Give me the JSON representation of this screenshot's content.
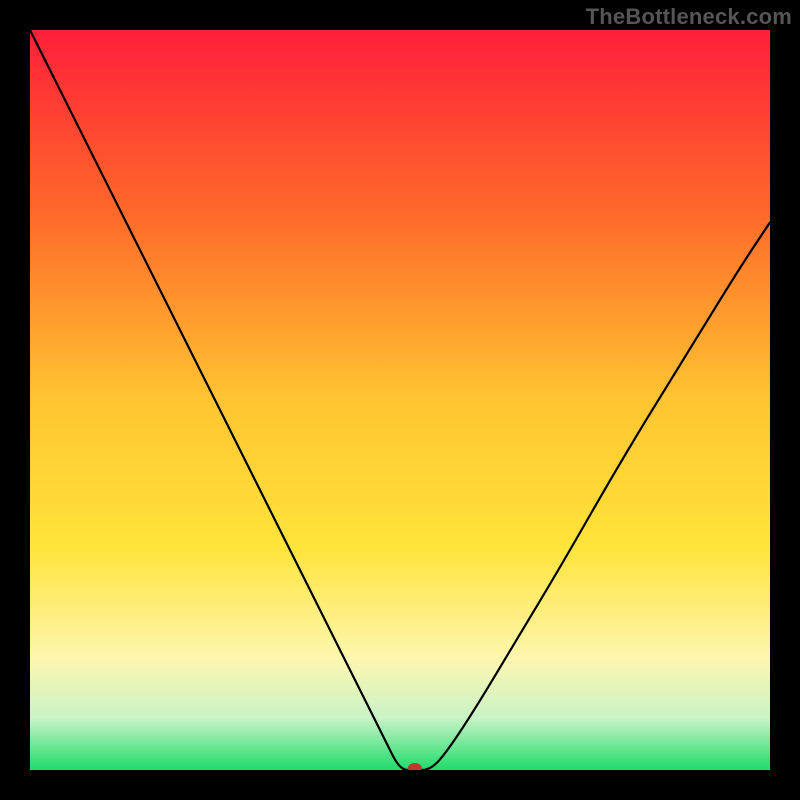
{
  "watermark": "TheBottleneck.com",
  "chart_data": {
    "type": "line",
    "title": "",
    "xlabel": "",
    "ylabel": "",
    "xlim": [
      0,
      100
    ],
    "ylim": [
      0,
      100
    ],
    "grid": false,
    "legend": false,
    "background_gradient": {
      "stops": [
        {
          "offset": 0.0,
          "color": "#ff1f3a"
        },
        {
          "offset": 0.25,
          "color": "#ff6a2a"
        },
        {
          "offset": 0.5,
          "color": "#ffc531"
        },
        {
          "offset": 0.7,
          "color": "#ffe43a"
        },
        {
          "offset": 0.85,
          "color": "#fdf6b0"
        },
        {
          "offset": 0.93,
          "color": "#c9f3c6"
        },
        {
          "offset": 1.0,
          "color": "#1fdc6b"
        }
      ]
    },
    "series": [
      {
        "name": "bottleneck-curve",
        "stroke": "#000000",
        "stroke_width": 2.2,
        "x": [
          0,
          4,
          8,
          12,
          16,
          20,
          24,
          28,
          32,
          36,
          40,
          44,
          48,
          50,
          52,
          54,
          56,
          60,
          66,
          72,
          80,
          88,
          96,
          100
        ],
        "y": [
          100,
          92,
          84,
          76,
          68,
          60,
          52,
          44,
          36,
          28,
          20,
          12,
          4,
          0,
          0,
          0,
          2,
          8,
          18,
          28,
          42,
          55,
          68,
          74
        ]
      }
    ],
    "marker": {
      "name": "optimum-marker",
      "x": 52,
      "y": 0,
      "rx": 7,
      "ry": 5,
      "fill": "#c0392b"
    }
  }
}
